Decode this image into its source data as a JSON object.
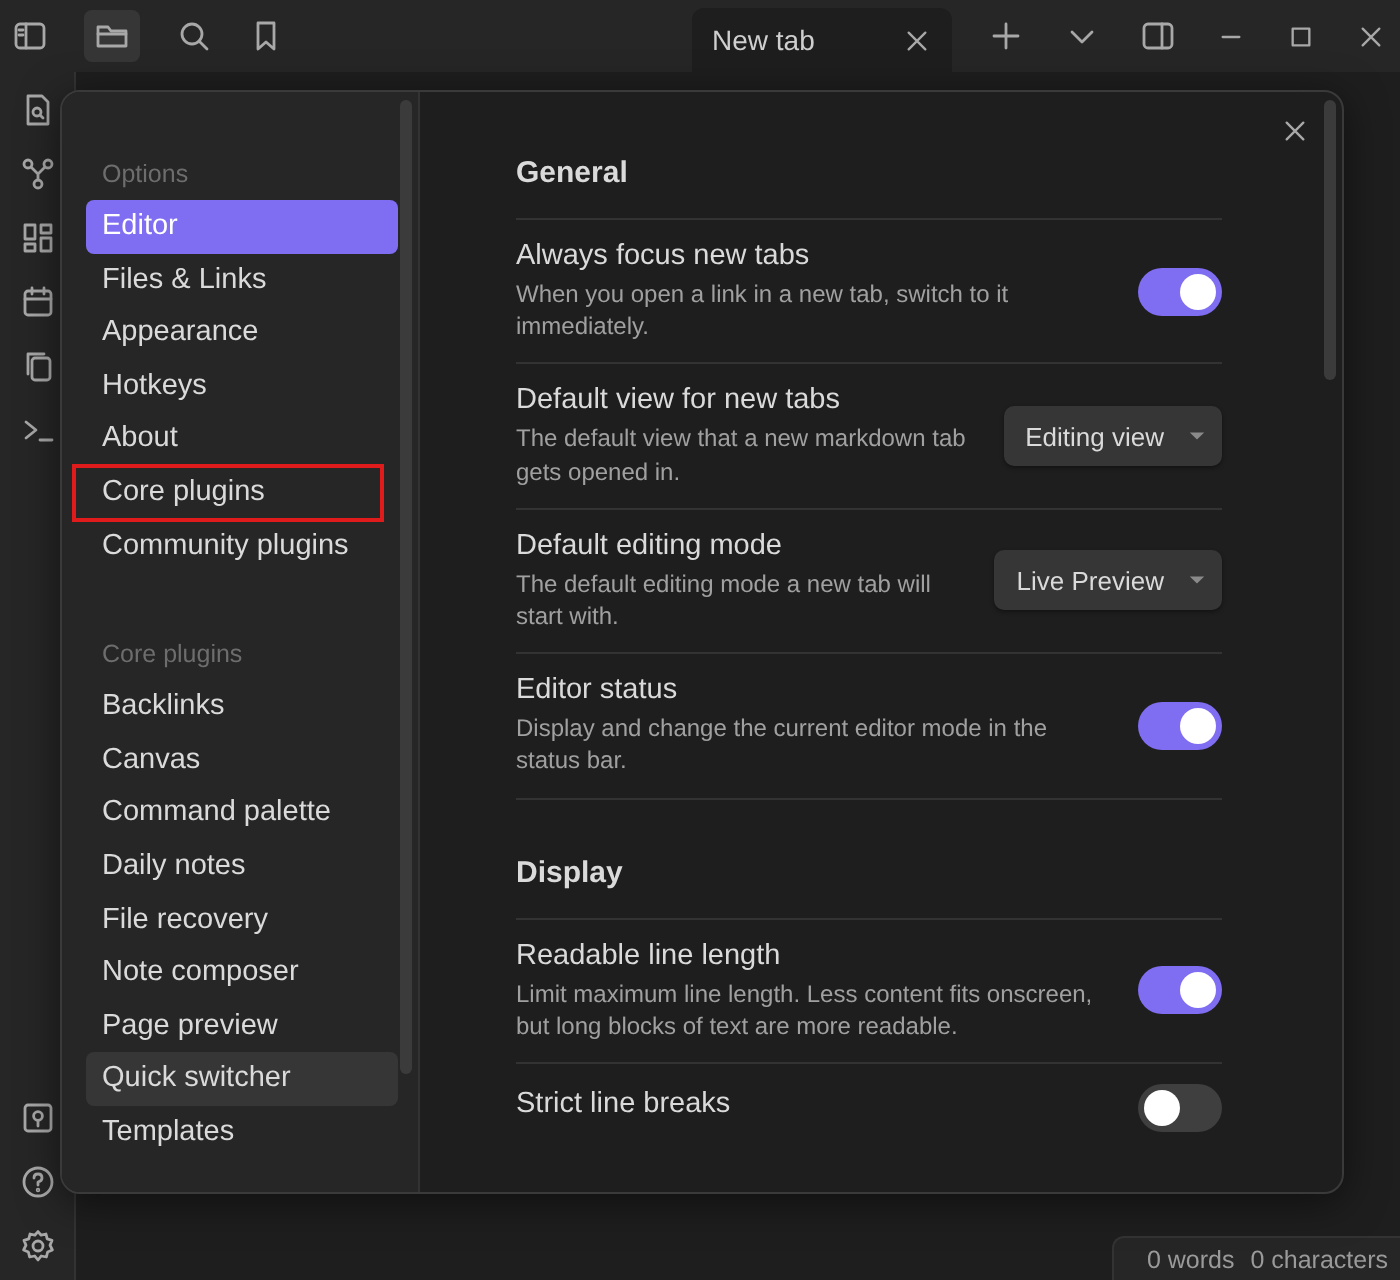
{
  "titlebar": {
    "tabs": [
      {
        "title": "New tab"
      }
    ]
  },
  "settings": {
    "sidebar": {
      "sections": [
        {
          "heading": "Options",
          "items": [
            {
              "label": "Editor",
              "selected": true,
              "hovered": false,
              "annotated": false
            },
            {
              "label": "Files & Links",
              "selected": false,
              "hovered": false,
              "annotated": false
            },
            {
              "label": "Appearance",
              "selected": false,
              "hovered": false,
              "annotated": false
            },
            {
              "label": "Hotkeys",
              "selected": false,
              "hovered": false,
              "annotated": false
            },
            {
              "label": "About",
              "selected": false,
              "hovered": false,
              "annotated": false
            },
            {
              "label": "Core plugins",
              "selected": false,
              "hovered": false,
              "annotated": true
            },
            {
              "label": "Community plugins",
              "selected": false,
              "hovered": false,
              "annotated": false
            }
          ]
        },
        {
          "heading": "Core plugins",
          "items": [
            {
              "label": "Backlinks",
              "selected": false,
              "hovered": false,
              "annotated": false
            },
            {
              "label": "Canvas",
              "selected": false,
              "hovered": false,
              "annotated": false
            },
            {
              "label": "Command palette",
              "selected": false,
              "hovered": false,
              "annotated": false
            },
            {
              "label": "Daily notes",
              "selected": false,
              "hovered": false,
              "annotated": false
            },
            {
              "label": "File recovery",
              "selected": false,
              "hovered": false,
              "annotated": false
            },
            {
              "label": "Note composer",
              "selected": false,
              "hovered": false,
              "annotated": false
            },
            {
              "label": "Page preview",
              "selected": false,
              "hovered": false,
              "annotated": false
            },
            {
              "label": "Quick switcher",
              "selected": false,
              "hovered": true,
              "annotated": false
            },
            {
              "label": "Templates",
              "selected": false,
              "hovered": false,
              "annotated": false
            }
          ]
        }
      ]
    },
    "content": {
      "sections": [
        {
          "heading": "General",
          "settings": [
            {
              "kind": "toggle",
              "name": "Always focus new tabs",
              "description": "When you open a link in a new tab, switch to it immediately.",
              "on": true
            },
            {
              "kind": "dropdown",
              "name": "Default view for new tabs",
              "description": "The default view that a new markdown tab gets opened in.",
              "value": "Editing view"
            },
            {
              "kind": "dropdown",
              "name": "Default editing mode",
              "description": "The default editing mode a new tab will start with.",
              "value": "Live Preview"
            },
            {
              "kind": "toggle",
              "name": "Editor status",
              "description": "Display and change the current editor mode in the status bar.",
              "on": true
            }
          ]
        },
        {
          "heading": "Display",
          "settings": [
            {
              "kind": "toggle",
              "name": "Readable line length",
              "description": "Limit maximum line length. Less content fits onscreen, but long blocks of text are more readable.",
              "on": true
            },
            {
              "kind": "toggle",
              "name": "Strict line breaks",
              "on": false
            }
          ]
        }
      ]
    }
  },
  "status_bar": [
    "0 words",
    "0 characters"
  ]
}
